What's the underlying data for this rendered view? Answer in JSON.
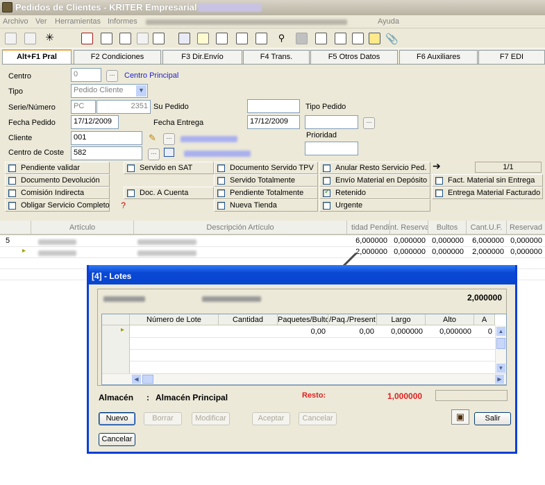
{
  "window": {
    "title": "Pedidos de Clientes - KRITER Empresarial - "
  },
  "menu": [
    "Archivo",
    "Ver",
    "Herramientas",
    "Informes",
    "Ayuda"
  ],
  "tabs": [
    "Alt+F1 Pral",
    "F2 Condiciones",
    "F3 Dir.Envío",
    "F4 Trans.",
    "F5 Otros Datos",
    "F6 Auxiliares",
    "F7 EDI"
  ],
  "form": {
    "centro_label": "Centro",
    "centro_value": "0",
    "centro_link": "Centro Principal",
    "tipo_label": "Tipo",
    "tipo_value": "Pedido Cliente",
    "serie_label": "Serie/Número",
    "serie_value": "PC",
    "numero_value": "2351",
    "supedido_label": "Su Pedido",
    "tipopedido_label": "Tipo Pedido",
    "fechapedido_label": "Fecha Pedido",
    "fechapedido_value": "17/12/2009",
    "fechaentrega_label": "Fecha Entrega",
    "fechaentrega_value": "17/12/2009",
    "prioridad_label": "Prioridad",
    "cliente_label": "Cliente",
    "cliente_value": "001",
    "coste_label": "Centro de Coste",
    "coste_value": "582",
    "page_counter": "1/1"
  },
  "checkboxes": [
    {
      "label": "Pendiente validar",
      "checked": false
    },
    {
      "label": "Documento Devolución",
      "checked": false
    },
    {
      "label": "Comisión Indirecta",
      "checked": false
    },
    {
      "label": "Obligar Servicio Completo",
      "checked": false
    },
    {
      "label": "Servido en SAT",
      "checked": false
    },
    {
      "label": "Doc. A Cuenta",
      "checked": false
    },
    {
      "label": "Documento Servido TPV",
      "checked": false
    },
    {
      "label": "Servido Totalmente",
      "checked": false
    },
    {
      "label": "Pendiente Totalmente",
      "checked": false
    },
    {
      "label": "Nueva Tienda",
      "checked": false
    },
    {
      "label": "Anular Resto Servicio Ped.",
      "checked": false
    },
    {
      "label": "Envío Material en Depósito",
      "checked": false
    },
    {
      "label": "Retenido",
      "checked": true
    },
    {
      "label": "Urgente",
      "checked": false
    },
    {
      "label": "Fact. Material sin Entrega",
      "checked": false
    },
    {
      "label": "Entrega Material Facturado",
      "checked": false
    }
  ],
  "grid": {
    "columns": [
      "Artículo",
      "Descripción Artículo",
      "tidad Pendi",
      "nt. Reserva",
      "Bultos",
      "Cant.U.F.",
      "Reservad"
    ],
    "rows": [
      {
        "num": "5",
        "values": [
          "6,000000",
          "0,000000",
          "0,000000",
          "6,000000",
          "0,000000"
        ]
      },
      {
        "num": "",
        "values": [
          "2,000000",
          "0,000000",
          "0,000000",
          "2,000000",
          "0,000000"
        ]
      }
    ]
  },
  "dialog": {
    "title": "[4] - Lotes",
    "total": "2,000000",
    "columns": [
      "Número de Lote",
      "Cantidad",
      "Paquetes/Bulto",
      "/Paq./Present",
      "Largo",
      "Alto",
      "A"
    ],
    "row": [
      "",
      "",
      "0,00",
      "0,00",
      "0,000000",
      "0,000000",
      "0"
    ],
    "almacen_label": "Almacén",
    "almacen_value": "Almacén Principal",
    "resto_label": "Resto:",
    "resto_value": "1,000000",
    "buttons": {
      "nuevo": "Nuevo",
      "borrar": "Borrar",
      "modificar": "Modificar",
      "aceptar": "Aceptar",
      "cancelar_dis": "Cancelar",
      "salir": "Salir",
      "cancelar": "Cancelar"
    }
  }
}
